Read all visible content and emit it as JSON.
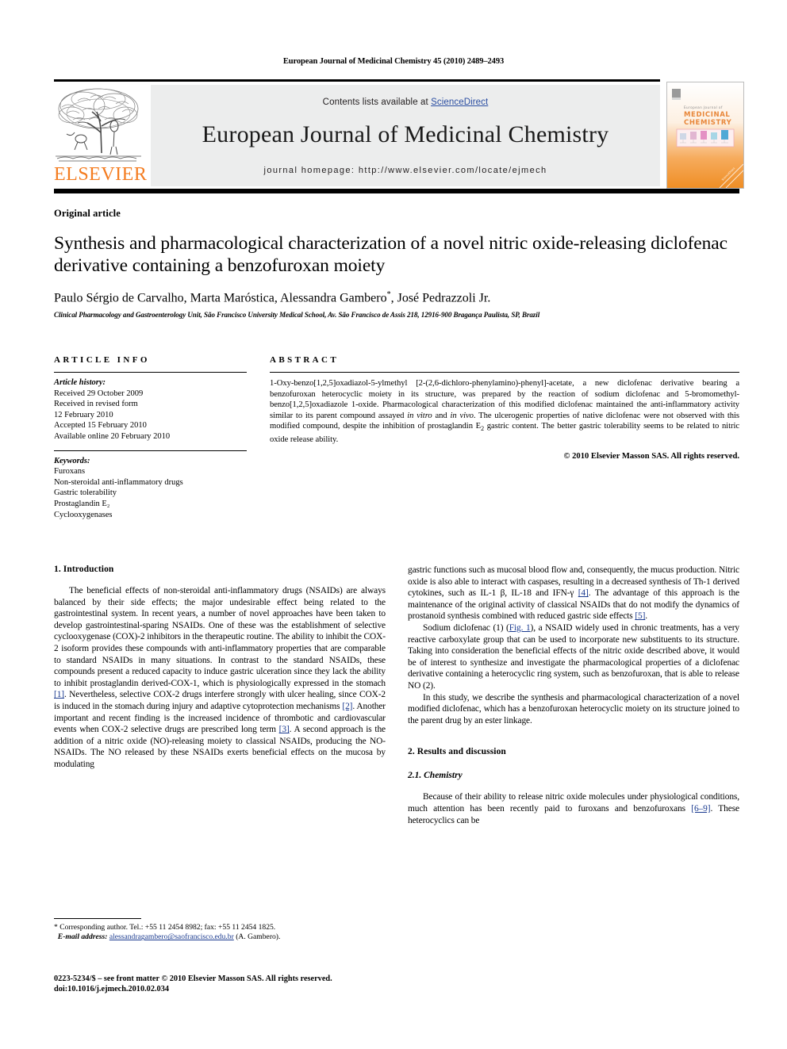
{
  "running_head": "European Journal of Medicinal Chemistry 45 (2010) 2489–2493",
  "masthead": {
    "contents_prefix": "Contents lists available at ",
    "sciencedirect": "ScienceDirect",
    "journal_title": "European Journal of Medicinal Chemistry",
    "homepage": "journal homepage: http://www.elsevier.com/locate/ejmech",
    "publisher_wordmark": "ELSEVIER",
    "cover_title_small": "European Journal of",
    "cover_title_line1": "MEDICINAL",
    "cover_title_line2": "CHEMISTRY",
    "accent_orange": "#F47C20",
    "link_blue": "#2b4ea2",
    "band_gray": "#eceded"
  },
  "article": {
    "kicker": "Original article",
    "title": "Synthesis and pharmacological characterization of a novel nitric oxide-releasing diclofenac derivative containing a benzofuroxan moiety",
    "authors": "Paulo Sérgio de Carvalho, Marta Maróstica, Alessandra Gambero",
    "corresponding_marker": "*",
    "authors_tail": ", José Pedrazzoli Jr.",
    "affiliation": "Clinical Pharmacology and Gastroenterology Unit, São Francisco University Medical School, Av. São Francisco de Assis 218, 12916-900 Bragança Paulista, SP, Brazil"
  },
  "article_info": {
    "heading": "ARTICLE INFO",
    "history_label": "Article history:",
    "history": [
      "Received 29 October 2009",
      "Received in revised form",
      "12 February 2010",
      "Accepted 15 February 2010",
      "Available online 20 February 2010"
    ],
    "keywords_label": "Keywords:",
    "keywords": [
      "Furoxans",
      "Non-steroidal anti-inflammatory drugs",
      "Gastric tolerability",
      "Prostaglandin E₂",
      "Cyclooxygenases"
    ]
  },
  "abstract": {
    "heading": "ABSTRACT",
    "text_part1": "1-Oxy-benzo[1,2,5]oxadiazol-5-ylmethyl [2-(2,6-dichloro-phenylamino)-phenyl]-acetate, a new diclofenac derivative bearing a benzofuroxan heterocyclic moiety in its structure, was prepared by the reaction of sodium diclofenac and 5-bromomethyl-benzo[1,2,5]oxadiazole 1-oxide. Pharmacological characterization of this modified diclofenac maintained the anti-inflammatory activity similar to its parent compound assayed ",
    "italic1": "in vitro",
    "text_mid": " and ",
    "italic2": "in vivo",
    "text_part2": ". The ulcerogenic properties of native diclofenac were not observed with this modified compound, despite the inhibition of prostaglandin E",
    "sub": "2",
    "text_part3": " gastric content. The better gastric tolerability seems to be related to nitric oxide release ability.",
    "copyright": "© 2010 Elsevier Masson SAS. All rights reserved."
  },
  "sections": {
    "introduction_heading": "1. Introduction",
    "results_heading": "2. Results and discussion",
    "chemistry_heading": "2.1. Chemistry"
  },
  "body": {
    "intro_p1_a": "The beneficial effects of non-steroidal anti-inflammatory drugs (NSAIDs) are always balanced by their side effects; the major undesirable effect being related to the gastrointestinal system. In recent years, a number of novel approaches have been taken to develop gastrointestinal-sparing NSAIDs. One of these was the establishment of selective cyclooxygenase (COX)-2 inhibitors in the therapeutic routine. The ability to inhibit the COX-2 isoform provides these compounds with anti-inflammatory properties that are comparable to standard NSAIDs in many situations. In contrast to the standard NSAIDs, these compounds present a reduced capacity to induce gastric ulceration since they lack the ability to inhibit prostaglandin derived-COX-1, which is physiologically expressed in the stomach ",
    "ref1": "[1]",
    "intro_p1_b": ". Nevertheless, selective COX-2 drugs interfere strongly with ulcer healing, since COX-2 is induced in the stomach during injury and adaptive cytoprotection mechanisms ",
    "ref2": "[2]",
    "intro_p1_c": ". Another important and recent finding is the increased incidence of thrombotic and cardiovascular events when COX-2 selective drugs are prescribed long term ",
    "ref3": "[3]",
    "intro_p1_d": ". A second approach is the addition of a nitric oxide (NO)-releasing moiety to classical NSAIDs, producing the NO-NSAIDs. The NO released by these NSAIDs exerts beneficial effects on the mucosa by modulating gastric functions such as mucosal blood flow and, consequently, the mucus production. Nitric oxide is also able to interact with caspases, resulting in a decreased synthesis of Th-1 derived cytokines, such as IL-1 β, IL-18 and IFN-γ ",
    "ref4": "[4]",
    "intro_p1_e": ". The advantage of this approach is the maintenance of the original activity of classical NSAIDs that do not modify the dynamics of prostanoid synthesis combined with reduced gastric side effects ",
    "ref5": "[5]",
    "intro_p1_f": ".",
    "intro_p2_a": "Sodium diclofenac (1) (",
    "figref1": "Fig. 1",
    "intro_p2_b": "), a NSAID widely used in chronic treatments, has a very reactive carboxylate group that can be used to incorporate new substituents to its structure. Taking into consideration the beneficial effects of the nitric oxide described above, it would be of interest to synthesize and investigate the pharmacological properties of a diclofenac derivative containing a heterocyclic ring system, such as benzofuroxan, that is able to release NO (2).",
    "intro_p3": "In this study, we describe the synthesis and pharmacological characterization of a novel modified diclofenac, which has a benzofuroxan heterocyclic moiety on its structure joined to the parent drug by an ester linkage.",
    "chem_p1_a": "Because of their ability to release nitric oxide molecules under physiological conditions, much attention has been recently paid to furoxans and benzofuroxans ",
    "ref69": "[6–9]",
    "chem_p1_b": ". These heterocyclics can be"
  },
  "footnote": {
    "corresponding": "* Corresponding author. Tel.: +55 11 2454 8982; fax: +55 11 2454 1825.",
    "email_label": "E-mail address:",
    "email": "alessandragambero@saofrancisco.edu.br",
    "email_suffix": " (A. Gambero)."
  },
  "colophon": {
    "line1": "0223-5234/$ – see front matter © 2010 Elsevier Masson SAS. All rights reserved.",
    "line2": "doi:10.1016/j.ejmech.2010.02.034"
  }
}
